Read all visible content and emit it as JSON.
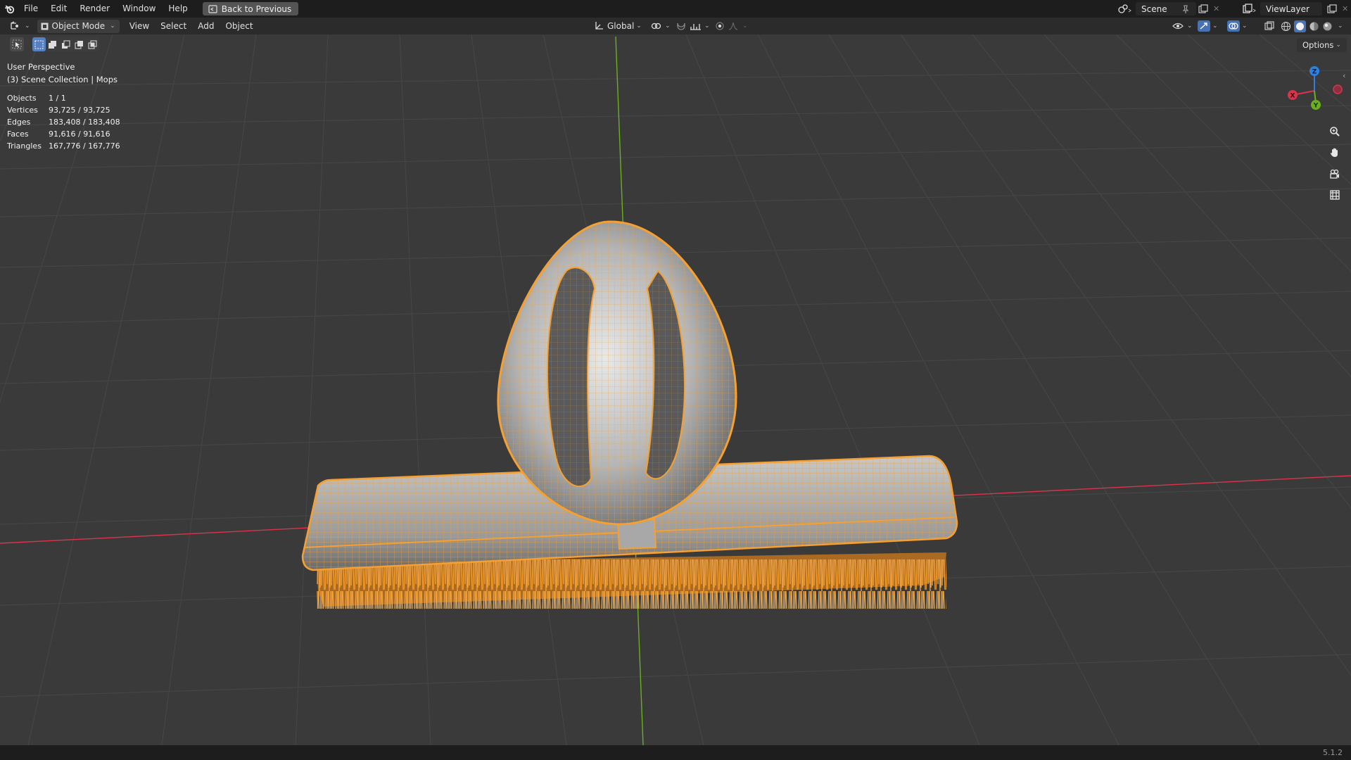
{
  "topbar": {
    "menus": [
      "File",
      "Edit",
      "Render",
      "Window",
      "Help"
    ],
    "back_label": "Back to Previous",
    "scene_name": "Scene",
    "view_layer": "ViewLayer"
  },
  "header": {
    "mode": "Object Mode",
    "menus": [
      "View",
      "Select",
      "Add",
      "Object"
    ],
    "transform_orientation": "Global",
    "options_label": "Options"
  },
  "viewport": {
    "perspective": "User Perspective",
    "collection": "(3) Scene Collection | Mops",
    "stats": [
      {
        "label": "Objects",
        "value": "1 / 1"
      },
      {
        "label": "Vertices",
        "value": "93,725 / 93,725"
      },
      {
        "label": "Edges",
        "value": "183,408 / 183,408"
      },
      {
        "label": "Faces",
        "value": "91,616 / 91,616"
      },
      {
        "label": "Triangles",
        "value": "167,776 / 167,776"
      }
    ],
    "gizmo": {
      "x": "X",
      "y": "Y",
      "z": "Z"
    }
  },
  "colors": {
    "selection": "#f5a030",
    "x_axis": "#d9344c",
    "y_axis": "#6ab01e",
    "z_axis": "#2f7fe0",
    "grid": "#4a4a4a",
    "background": "#3a3a3a"
  },
  "statusbar": {
    "version": "5.1.2"
  }
}
